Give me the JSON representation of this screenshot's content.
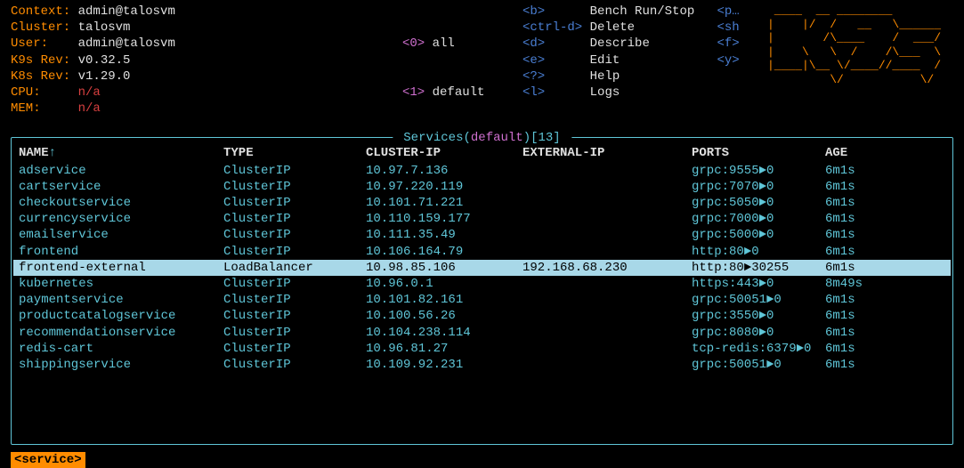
{
  "header": {
    "context_label": "Context:",
    "context_value": "admin@talosvm",
    "cluster_label": "Cluster:",
    "cluster_value": "talosvm",
    "user_label": "User:",
    "user_value": "admin@talosvm",
    "k9s_rev_label": "K9s Rev:",
    "k9s_rev_value": "v0.32.5",
    "k8s_rev_label": "K8s Rev:",
    "k8s_rev_value": "v1.29.0",
    "cpu_label": "CPU:",
    "cpu_value": "n/a",
    "mem_label": "MEM:",
    "mem_value": "n/a"
  },
  "filters": [
    {
      "key": "<0>",
      "label": "all"
    },
    {
      "key": "<1>",
      "label": "default"
    }
  ],
  "shortcuts": [
    {
      "key": "<b>",
      "label": "Bench Run/Stop",
      "extra": "<p…"
    },
    {
      "key": "<ctrl-d>",
      "label": "Delete",
      "extra": "<sh"
    },
    {
      "key": "<d>",
      "label": "Describe",
      "extra": "<f>"
    },
    {
      "key": "<e>",
      "label": "Edit",
      "extra": "<y>"
    },
    {
      "key": "<?>",
      "label": "Help",
      "extra": ""
    },
    {
      "key": "<l>",
      "label": "Logs",
      "extra": ""
    }
  ],
  "logo": " ____  __ ________       \n|    |/  /   __   \\______\n|       /\\____    /  ___/\n|    \\   \\  /    /\\___  \\\n|____|\\__ \\/____//____  /\n         \\/           \\/ ",
  "panel": {
    "title_prefix": " Services(",
    "title_ns": "default",
    "title_count": ")[13] ",
    "columns": [
      "NAME",
      "TYPE",
      "CLUSTER-IP",
      "EXTERNAL-IP",
      "PORTS",
      "AGE"
    ],
    "sort_arrow": "↑"
  },
  "rows": [
    {
      "name": "adservice",
      "type": "ClusterIP",
      "clusterip": "10.97.7.136",
      "externalip": "",
      "ports": "grpc:9555►0",
      "age": "6m1s",
      "selected": false
    },
    {
      "name": "cartservice",
      "type": "ClusterIP",
      "clusterip": "10.97.220.119",
      "externalip": "",
      "ports": "grpc:7070►0",
      "age": "6m1s",
      "selected": false
    },
    {
      "name": "checkoutservice",
      "type": "ClusterIP",
      "clusterip": "10.101.71.221",
      "externalip": "",
      "ports": "grpc:5050►0",
      "age": "6m1s",
      "selected": false
    },
    {
      "name": "currencyservice",
      "type": "ClusterIP",
      "clusterip": "10.110.159.177",
      "externalip": "",
      "ports": "grpc:7000►0",
      "age": "6m1s",
      "selected": false
    },
    {
      "name": "emailservice",
      "type": "ClusterIP",
      "clusterip": "10.111.35.49",
      "externalip": "",
      "ports": "grpc:5000►0",
      "age": "6m1s",
      "selected": false
    },
    {
      "name": "frontend",
      "type": "ClusterIP",
      "clusterip": "10.106.164.79",
      "externalip": "",
      "ports": "http:80►0",
      "age": "6m1s",
      "selected": false
    },
    {
      "name": "frontend-external",
      "type": "LoadBalancer",
      "clusterip": "10.98.85.106",
      "externalip": "192.168.68.230",
      "ports": "http:80►30255",
      "age": "6m1s",
      "selected": true
    },
    {
      "name": "kubernetes",
      "type": "ClusterIP",
      "clusterip": "10.96.0.1",
      "externalip": "",
      "ports": "https:443►0",
      "age": "8m49s",
      "selected": false
    },
    {
      "name": "paymentservice",
      "type": "ClusterIP",
      "clusterip": "10.101.82.161",
      "externalip": "",
      "ports": "grpc:50051►0",
      "age": "6m1s",
      "selected": false
    },
    {
      "name": "productcatalogservice",
      "type": "ClusterIP",
      "clusterip": "10.100.56.26",
      "externalip": "",
      "ports": "grpc:3550►0",
      "age": "6m1s",
      "selected": false
    },
    {
      "name": "recommendationservice",
      "type": "ClusterIP",
      "clusterip": "10.104.238.114",
      "externalip": "",
      "ports": "grpc:8080►0",
      "age": "6m1s",
      "selected": false
    },
    {
      "name": "redis-cart",
      "type": "ClusterIP",
      "clusterip": "10.96.81.27",
      "externalip": "",
      "ports": "tcp-redis:6379►0",
      "age": "6m1s",
      "selected": false
    },
    {
      "name": "shippingservice",
      "type": "ClusterIP",
      "clusterip": "10.109.92.231",
      "externalip": "",
      "ports": "grpc:50051►0",
      "age": "6m1s",
      "selected": false
    }
  ],
  "breadcrumb": "<service>"
}
